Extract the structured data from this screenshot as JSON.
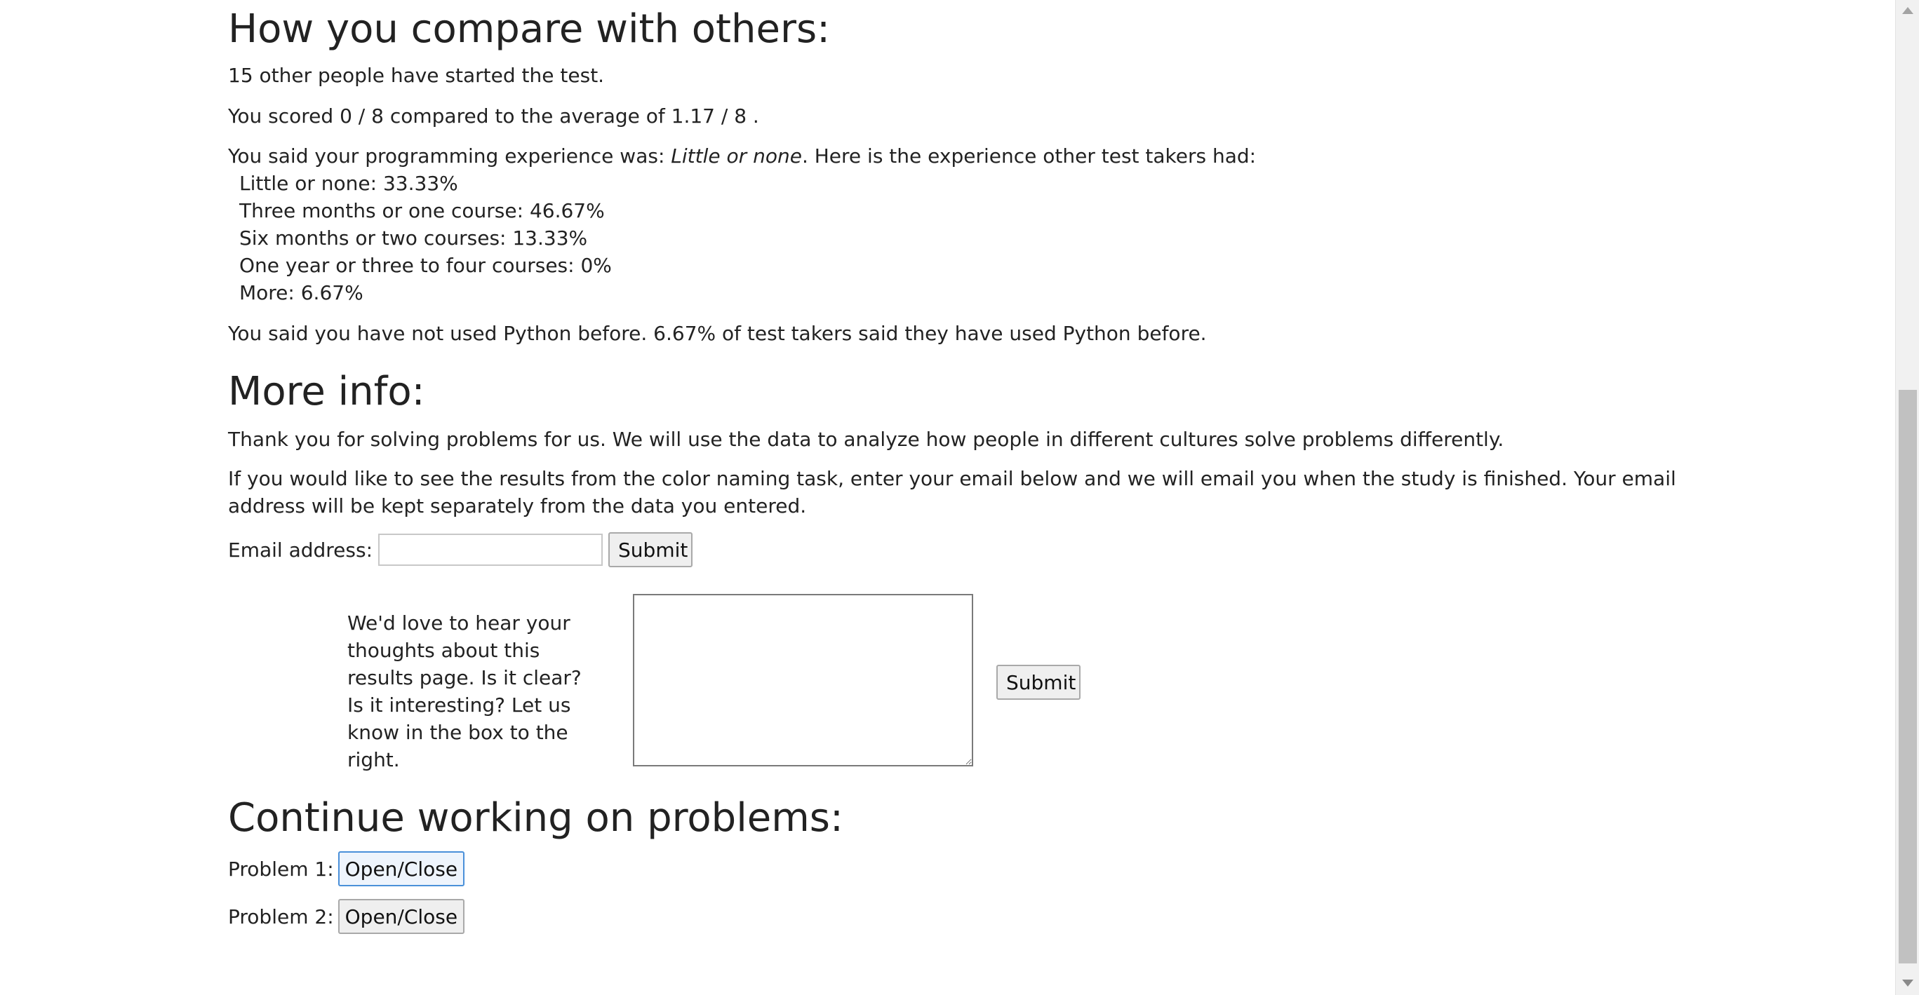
{
  "compare": {
    "heading": "How you compare with others:",
    "started_text": "15 other people have started the test.",
    "score_text": "You scored 0 / 8 compared to the average of 1.17 / 8 .",
    "experience_intro": "You said your programming experience was: ",
    "experience_value": "Little or none",
    "experience_outro": ". Here is the experience other test takers had:",
    "experience_breakdown": [
      "Little or none: 33.33%",
      "Three months or one course: 46.67%",
      "Six months or two courses: 13.33%",
      "One year or three to four courses: 0%",
      "More: 6.67%"
    ],
    "python_text": "You said you have not used Python before. 6.67% of test takers said they have used Python before."
  },
  "more_info": {
    "heading": "More info:",
    "thanks_text": "Thank you for solving problems for us. We will use the data to analyze how people in different cultures solve problems differently.",
    "results_text": "If you would like to see the results from the color naming task, enter your email below and we will email you when the study is finished. Your email address will be kept separately from the data you entered.",
    "email_label": "Email address:",
    "email_value": "",
    "email_submit_label": "Submit",
    "feedback_prompt": "We'd love to hear your thoughts about this results page. Is it clear? Is it interesting? Let us know in the box to the right.",
    "feedback_value": "",
    "feedback_submit_label": "Submit"
  },
  "continue": {
    "heading": "Continue working on problems:",
    "problems": [
      {
        "label": "Problem 1:",
        "button_label": "Open/Close"
      },
      {
        "label": "Problem 2:",
        "button_label": "Open/Close"
      }
    ]
  },
  "scrollbar": {
    "position_fraction": 1.0
  }
}
